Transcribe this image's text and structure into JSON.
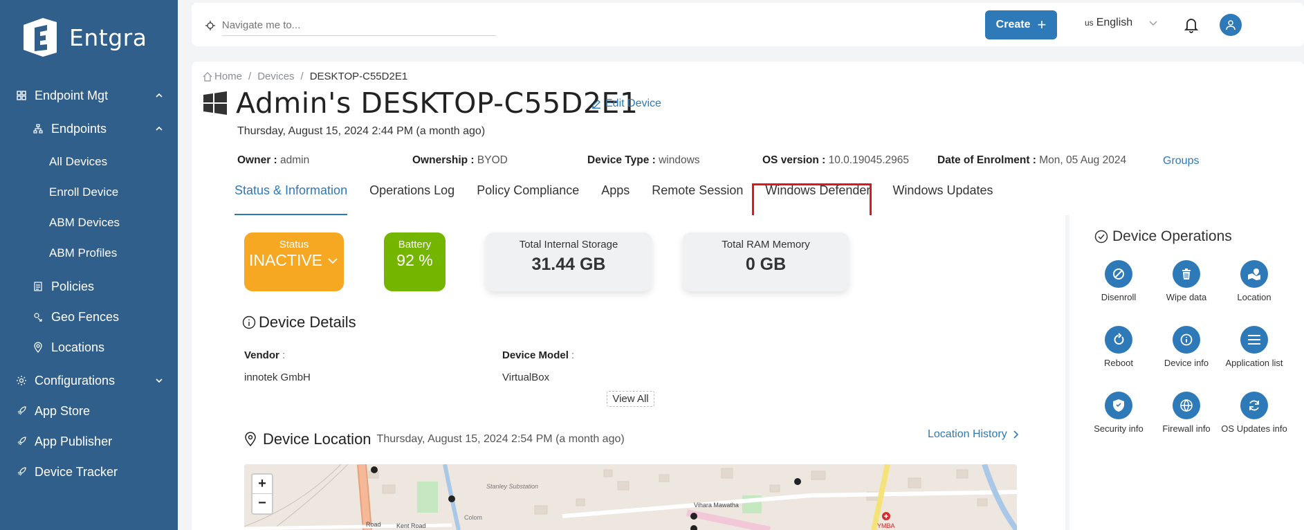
{
  "brand": {
    "name": "Entgra"
  },
  "sidebar": {
    "items": [
      {
        "label": "Endpoint Mgt",
        "icon": "grid-icon"
      },
      {
        "label": "Endpoints",
        "icon": "sitemap-icon"
      },
      {
        "label": "All Devices"
      },
      {
        "label": "Enroll Device"
      },
      {
        "label": "ABM Devices"
      },
      {
        "label": "ABM Profiles"
      },
      {
        "label": "Policies",
        "icon": "clipboard-icon"
      },
      {
        "label": "Geo Fences",
        "icon": "geofence-icon"
      },
      {
        "label": "Locations",
        "icon": "pin-icon"
      },
      {
        "label": "Configurations",
        "icon": "gear-icon"
      },
      {
        "label": "App Store",
        "icon": "rocket-icon"
      },
      {
        "label": "App Publisher",
        "icon": "rocket-icon"
      },
      {
        "label": "Device Tracker",
        "icon": "rocket-icon"
      }
    ]
  },
  "topbar": {
    "search_placeholder": "Navigate me to...",
    "create_label": "Create",
    "language_flag": "us",
    "language_label": "English"
  },
  "breadcrumb": {
    "home": "Home",
    "devices": "Devices",
    "current": "DESKTOP-C55D2E1"
  },
  "device": {
    "title": "Admin's DESKTOP-C55D2E1",
    "edit_label": "Edit Device",
    "last_seen": "Thursday, August 15, 2024 2:44 PM (a month ago)",
    "owner_label": "Owner :",
    "owner": "admin",
    "ownership_label": "Ownership :",
    "ownership": "BYOD",
    "type_label": "Device Type :",
    "type": "windows",
    "os_label": "OS version :",
    "os": "10.0.19045.2965",
    "enrol_label": "Date of Enrolment :",
    "enrol": "Mon, 05 Aug 2024",
    "groups_label": "Groups"
  },
  "tabs": [
    {
      "label": "Status & Information",
      "active": true
    },
    {
      "label": "Operations Log"
    },
    {
      "label": "Policy Compliance"
    },
    {
      "label": "Apps"
    },
    {
      "label": "Remote Session"
    },
    {
      "label": "Windows Defender",
      "highlighted": true
    },
    {
      "label": "Windows Updates"
    }
  ],
  "stats": {
    "status_label": "Status",
    "status_value": "INACTIVE",
    "battery_label": "Battery",
    "battery_value": "92 %",
    "storage_label": "Total Internal Storage",
    "storage_value": "31.44 GB",
    "ram_label": "Total RAM Memory",
    "ram_value": "0 GB"
  },
  "details": {
    "title": "Device Details",
    "vendor_label": "Vendor",
    "vendor": "innotek GmbH",
    "model_label": "Device Model",
    "model": "VirtualBox",
    "view_all": "View All"
  },
  "location": {
    "title": "Device Location",
    "date": "Thursday, August 15, 2024 2:54 PM (a month ago)",
    "history_label": "Location History",
    "map_labels": [
      "Stanley Substation",
      "Vihara Mawatha",
      "Kent Road",
      "Road",
      "YMBA",
      "Colom"
    ]
  },
  "operations": {
    "title": "Device Operations",
    "items": [
      {
        "label": "Disenroll",
        "icon": "ban-icon"
      },
      {
        "label": "Wipe data",
        "icon": "trash-icon"
      },
      {
        "label": "Location",
        "icon": "map-marker-icon"
      },
      {
        "label": "Reboot",
        "icon": "reboot-icon"
      },
      {
        "label": "Device info",
        "icon": "info-icon"
      },
      {
        "label": "Application list",
        "icon": "list-icon"
      },
      {
        "label": "Security info",
        "icon": "shield-icon"
      },
      {
        "label": "Firewall info",
        "icon": "globe-icon"
      },
      {
        "label": "OS Updates info",
        "icon": "sync-icon"
      }
    ]
  },
  "colors": {
    "sidebar": "#2f5f8a",
    "accent": "#2e79b7",
    "status": "#f7a823",
    "battery": "#74b500",
    "highlight": "#e0161e"
  }
}
